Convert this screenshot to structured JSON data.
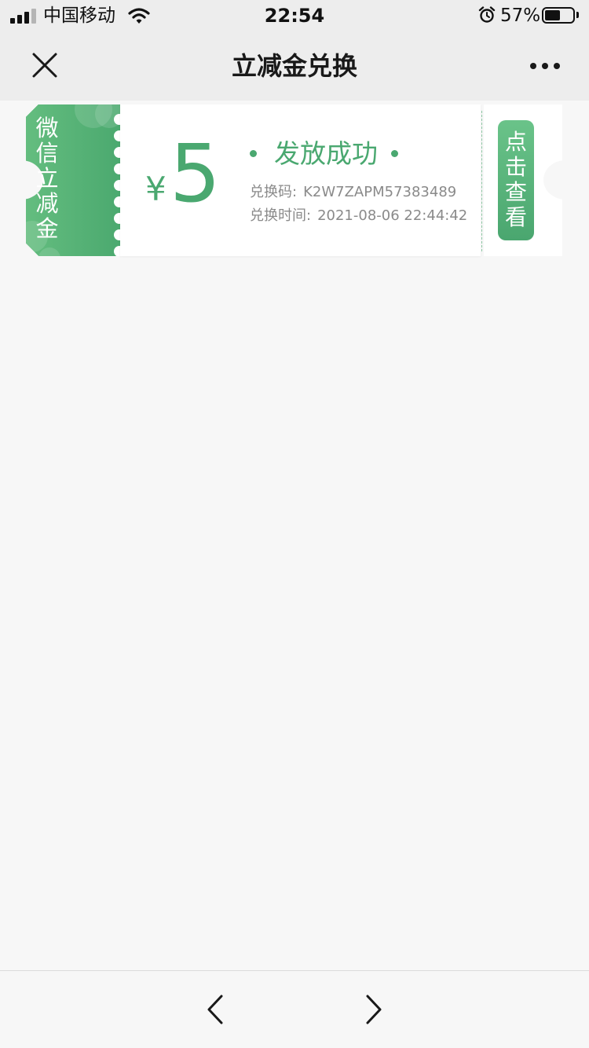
{
  "status_bar": {
    "carrier": "中国移动",
    "time": "22:54",
    "battery_percent_text": "57%",
    "battery_level": 0.57,
    "icons": [
      "signal-icon",
      "wifi-icon",
      "alarm-icon",
      "battery-icon"
    ]
  },
  "nav": {
    "title": "立减金兑换",
    "left_icon": "close-icon",
    "right_icon": "more-icon"
  },
  "coupon": {
    "brand_label": "微信立减金",
    "currency_symbol": "¥",
    "amount": "5",
    "status": "发放成功",
    "code_label": "兑换码:",
    "code_value": "K2W7ZAPM57383489",
    "time_label": "兑换时间:",
    "time_value": "2021-08-06 22:44:42",
    "view_button_label": "点击查看"
  },
  "toolbar": {
    "back_icon": "chevron-left-icon",
    "forward_icon": "chevron-right-icon"
  },
  "colors": {
    "accent_green": "#4aa870",
    "page_background": "#f7f7f7",
    "bar_background": "#ededed",
    "secondary_text": "#8a8a8a"
  }
}
